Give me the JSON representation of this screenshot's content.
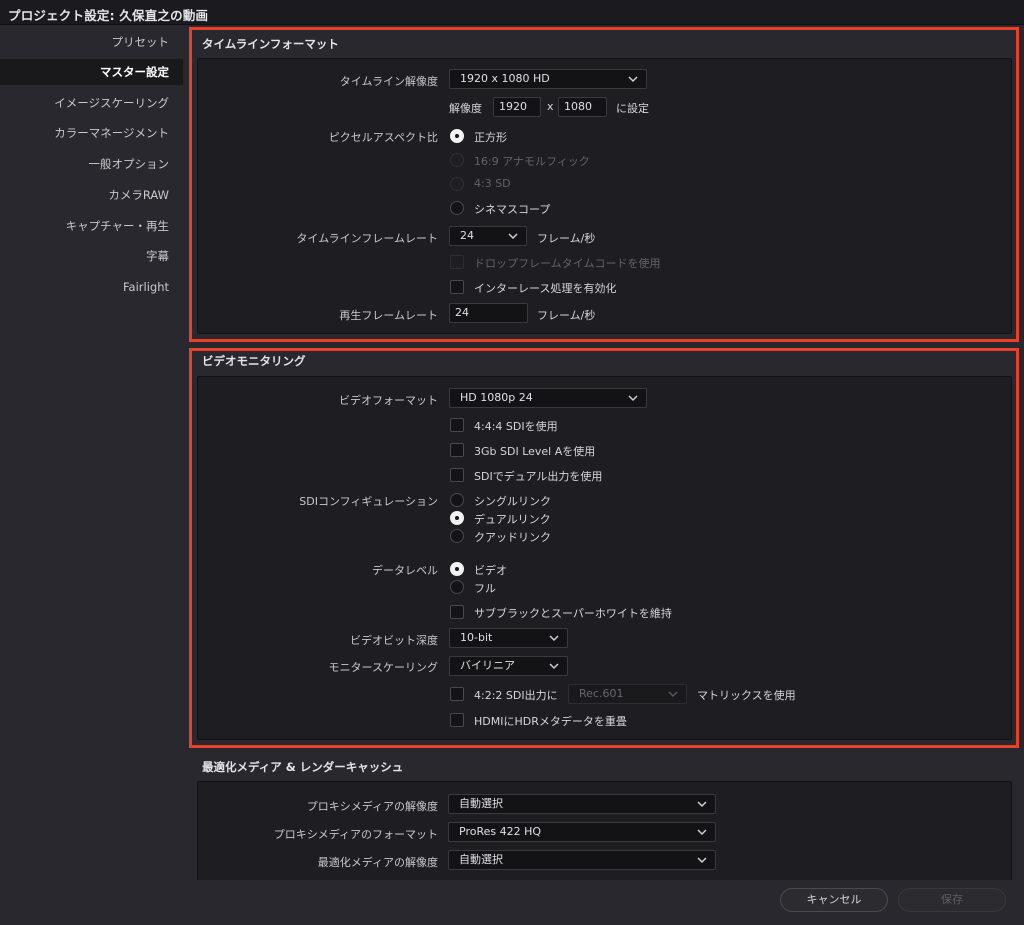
{
  "window": {
    "title": "プロジェクト設定:  久保直之の動画"
  },
  "sidebar": {
    "items": [
      {
        "label": "プリセット"
      },
      {
        "label": "マスター設定"
      },
      {
        "label": "イメージスケーリング"
      },
      {
        "label": "カラーマネージメント"
      },
      {
        "label": "一般オプション"
      },
      {
        "label": "カメラRAW"
      },
      {
        "label": "キャプチャー・再生"
      },
      {
        "label": "字幕"
      },
      {
        "label": "Fairlight"
      }
    ]
  },
  "timeline_format": {
    "title": "タイムラインフォーマット",
    "resolution_label": "タイムライン解像度",
    "resolution_value": "1920 x 1080 HD",
    "size_label": "解像度",
    "width": "1920",
    "x_sep": "x",
    "height": "1080",
    "set_label": "に設定",
    "pixel_aspect_label": "ピクセルアスペクト比",
    "pixel_aspect_options": [
      "正方形",
      "16:9 アナモルフィック",
      "4:3 SD",
      "シネマスコープ"
    ],
    "frame_rate_label": "タイムラインフレームレート",
    "frame_rate_value": "24",
    "fps_unit": "フレーム/秒",
    "drop_frame_label": "ドロップフレームタイムコードを使用",
    "interlace_label": "インターレース処理を有効化",
    "playback_rate_label": "再生フレームレート",
    "playback_rate_value": "24",
    "playback_unit": "フレーム/秒"
  },
  "video_monitoring": {
    "title": "ビデオモニタリング",
    "video_format_label": "ビデオフォーマット",
    "video_format_value": "HD 1080p 24",
    "use_444_sdi": "4:4:4 SDIを使用",
    "use_3gb_sdi": "3Gb SDI Level Aを使用",
    "use_dual_output": "SDIでデュアル出力を使用",
    "sdi_config_label": "SDIコンフィギュレーション",
    "sdi_options": [
      "シングルリンク",
      "デュアルリンク",
      "クアッドリンク"
    ],
    "data_level_label": "データレベル",
    "data_level_options": [
      "ビデオ",
      "フル"
    ],
    "retain_sub_black": "サブブラックとスーパーホワイトを維持",
    "bit_depth_label": "ビデオビット深度",
    "bit_depth_value": "10-bit",
    "monitor_scaling_label": "モニタースケーリング",
    "monitor_scaling_value": "バイリニア",
    "sdi_422_label": "4:2:2 SDI出力に",
    "matrix_value": "Rec.601",
    "matrix_label": "マトリックスを使用",
    "hdmi_hdr_label": "HDMIにHDRメタデータを重畳"
  },
  "optimized_media": {
    "title": "最適化メディア & レンダーキャッシュ",
    "proxy_res_label": "プロキシメディアの解像度",
    "proxy_res_value": "自動選択",
    "proxy_format_label": "プロキシメディアのフォーマット",
    "proxy_format_value": "ProRes 422 HQ",
    "optimized_res_label": "最適化メディアの解像度",
    "optimized_res_value": "自動選択"
  },
  "footer": {
    "cancel": "キャンセル",
    "save": "保存"
  },
  "colors": {
    "accent_red": "#e8412a",
    "panel": "#1e1e22",
    "background": "#28282e"
  }
}
